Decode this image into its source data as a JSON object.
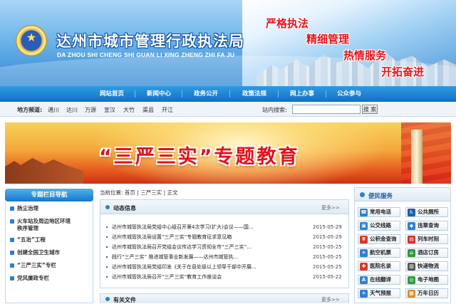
{
  "header": {
    "title": "达州市城市管理行政执法局",
    "pinyin": "DA ZHOU SHI CHENG SHI GUAN LI XING ZHENG ZHI FA JU",
    "slogans": [
      "严格执法",
      "精细管理",
      "热情服务",
      "开拓奋进"
    ]
  },
  "nav": {
    "items": [
      "网站首页",
      "新闻中心",
      "政务公开",
      "政策法规",
      "网上办事",
      "公众参与"
    ]
  },
  "subbar": {
    "label": "地方频道:",
    "channels": [
      "通川",
      "达川",
      "万源",
      "宣汉",
      "大竹",
      "渠县",
      "开江"
    ],
    "search_label": "站内搜索:",
    "search_value": "",
    "search_button": "搜 索"
  },
  "promo": {
    "title": "“三严三实”专题教育"
  },
  "sidebar": {
    "heading": "专题栏目导航",
    "items": [
      "扬尘治理",
      "火车站及周边地区环境\n秩序管理",
      "“五治”工程",
      "创建全国卫生城市",
      "“三严三实”专栏",
      "党风廉政专栏"
    ]
  },
  "breadcrumb": {
    "text": "当前位置: 首页 | 三严三实 | 正文"
  },
  "news_panel": {
    "title": "动态信息",
    "more": "更多>>",
    "items": [
      {
        "title": "达州市城管执法局党组中心组召开第4次学习(扩大)会议——国...",
        "date": "2015-05-29"
      },
      {
        "title": "达州市城管执法局设置“三严三实”专题教育征求意见箱",
        "date": "2015-05-29"
      },
      {
        "title": "达州市城管执法局召开党组会议传达学习贯彻全市“三严三实”...",
        "date": "2015-05-25"
      },
      {
        "title": "践行“三严三实” 推进城管事业新发展——达州市城管执...",
        "date": "2015-05-25"
      },
      {
        "title": "达州市城管执法局党组印发《关于在县处级以上领导干部中开展...",
        "date": "2015-05-25"
      },
      {
        "title": "达州市城管执法局召开“三严三实”教育工作座谈会",
        "date": "2015-05-22"
      }
    ]
  },
  "files_panel": {
    "title": "有关文件",
    "more": "更多>>"
  },
  "convenience": {
    "title": "便民服务",
    "items": [
      {
        "label": "常用电话",
        "icon": "phone-icon",
        "color": "#2f7fd1"
      },
      {
        "label": "公共厕所",
        "icon": "toilet-icon",
        "color": "#1d5fae"
      },
      {
        "label": "公交线路",
        "icon": "bus-icon",
        "color": "#2f7fd1"
      },
      {
        "label": "违章查询",
        "icon": "car-icon",
        "color": "#2f7fd1"
      },
      {
        "label": "公积金查询",
        "icon": "fund-icon",
        "color": "#d63a2a"
      },
      {
        "label": "列车时刻",
        "icon": "train-icon",
        "color": "#c9302c"
      },
      {
        "label": "航空机票",
        "icon": "plane-icon",
        "color": "#2f7fd1"
      },
      {
        "label": "酒店订房",
        "icon": "hotel-icon",
        "color": "#2f9a3c"
      },
      {
        "label": "医院名录",
        "icon": "hospital-icon",
        "color": "#d63a2a"
      },
      {
        "label": "快递物流",
        "icon": "truck-icon",
        "color": "#555555"
      },
      {
        "label": "在线翻译",
        "icon": "translate-icon",
        "color": "#2f7fd1"
      },
      {
        "label": "电子地图",
        "icon": "map-icon",
        "color": "#2f9a3c"
      },
      {
        "label": "天气预报",
        "icon": "weather-icon",
        "color": "#2f7fd1"
      },
      {
        "label": "万年日历",
        "icon": "calendar-icon",
        "color": "#d6902a"
      }
    ]
  }
}
